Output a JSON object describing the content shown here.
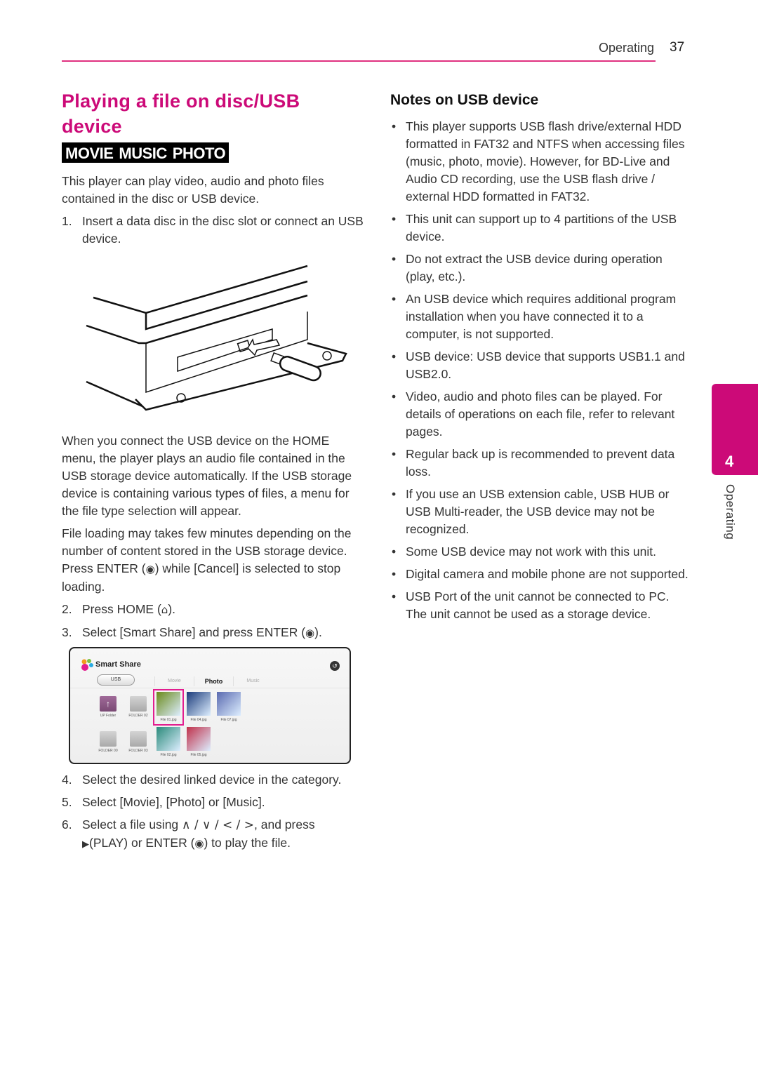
{
  "header": {
    "section": "Operating",
    "page_number": "37"
  },
  "left": {
    "title": "Playing a file on disc/USB device",
    "badges": [
      "MOVIE",
      "MUSIC",
      "PHOTO"
    ],
    "intro": "This player can play video, audio and photo files contained in the disc or USB device.",
    "step1": {
      "num": "1.",
      "text": "Insert a data disc in the disc slot or connect an USB device."
    },
    "para1": "When you connect the USB device on the HOME menu, the player plays an audio file contained in the USB storage device automatically. If the USB storage device is containing various types of files, a menu for the file type selection will appear.",
    "para2_a": "File loading may takes few minutes depending on the number of content stored in the USB storage device. Press ENTER (",
    "para2_b": ") while [Cancel] is selected to stop loading.",
    "step2": {
      "num": "2.",
      "text_a": "Press HOME (",
      "text_b": ")."
    },
    "step3": {
      "num": "3.",
      "text_a": "Select [Smart Share] and press ENTER (",
      "text_b": ")."
    },
    "step4": {
      "num": "4.",
      "text": "Select the desired linked device in the category."
    },
    "step5": {
      "num": "5.",
      "text": "Select [Movie], [Photo] or [Music]."
    },
    "step6": {
      "num": "6.",
      "text_a": "Select a file using ",
      "arrows": "∧ / ∨ / < / >",
      "text_b": ", and press ",
      "play": "▶",
      "text_c": "(PLAY) or ENTER (",
      "text_d": ") to play the file."
    },
    "icons": {
      "enter": "◉",
      "home": "⌂"
    }
  },
  "smart_share": {
    "title": "Smart Share",
    "device": "USB",
    "tabs": [
      "Movie",
      "Photo",
      "Music"
    ],
    "active_tab": "Photo",
    "back_icon": "↺",
    "items": [
      {
        "label": "UP Folder",
        "type": "up-folder"
      },
      {
        "label": "FOLDER 02",
        "type": "folder"
      },
      {
        "label": "File 01.jpg",
        "type": "photo",
        "selected": true,
        "color": "#6a8a1a"
      },
      {
        "label": "File 04.jpg",
        "type": "photo",
        "color": "#1a3a7a"
      },
      {
        "label": "File 07.jpg",
        "type": "photo",
        "color": "#5a6ab0"
      },
      {
        "label": "FOLDER 00",
        "type": "folder"
      },
      {
        "label": "FOLDER 03",
        "type": "folder"
      },
      {
        "label": "File 02.jpg",
        "type": "photo",
        "color": "#2a8a7a"
      },
      {
        "label": "File 05.jpg",
        "type": "photo",
        "color": "#c0304a"
      }
    ]
  },
  "right": {
    "title": "Notes on USB device",
    "bullets": [
      "This player supports USB flash drive/external HDD formatted in FAT32 and NTFS when accessing files (music, photo, movie). However, for BD-Live and Audio CD recording, use the USB flash drive / external HDD formatted in FAT32.",
      "This unit can support up to 4 partitions of the USB device.",
      "Do not extract the USB device during operation (play, etc.).",
      "An USB device which requires additional program installation when you have connected it to a computer, is not supported.",
      "USB device: USB device that supports USB1.1 and USB2.0.",
      "Video, audio and photo files can be played. For details of operations on each file, refer to relevant pages.",
      "Regular back up is recommended to prevent data loss.",
      "If you use an USB extension cable, USB HUB or USB Multi-reader, the USB device may not be recognized.",
      "Some USB device may not work with this unit.",
      "Digital camera and mobile phone are not supported.",
      "USB Port of the unit cannot be connected to PC. The unit cannot be used as a storage device."
    ],
    "bullet_char": "•"
  },
  "side_tab": {
    "number": "4",
    "label": "Operating"
  },
  "colors": {
    "accent": "#cc0a78",
    "rule": "#e0307f"
  }
}
